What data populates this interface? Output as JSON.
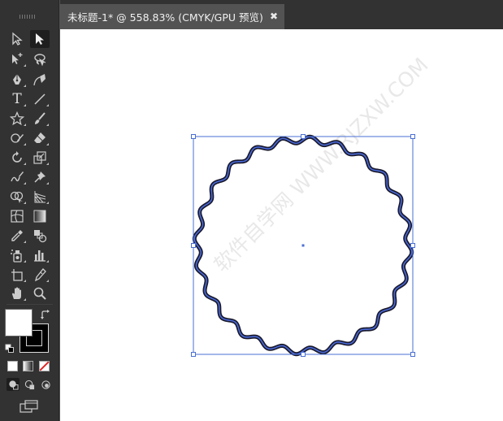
{
  "document_tab": {
    "title": "未标题-1* @ 558.83% (CMYK/GPU 预览)",
    "close_glyph": "✖"
  },
  "toolbar": {
    "tools": [
      {
        "name": "direct-selection-icon"
      },
      {
        "name": "selection-icon",
        "active": true
      },
      {
        "name": "magic-wand-icon"
      },
      {
        "name": "lasso-icon"
      },
      {
        "name": "pen-icon"
      },
      {
        "name": "curvature-icon"
      },
      {
        "name": "type-icon",
        "glyph": "T"
      },
      {
        "name": "line-segment-icon"
      },
      {
        "name": "star-icon"
      },
      {
        "name": "paintbrush-icon"
      },
      {
        "name": "shaper-icon"
      },
      {
        "name": "eraser-icon"
      },
      {
        "name": "rotate-icon"
      },
      {
        "name": "scale-icon"
      },
      {
        "name": "warp-icon"
      },
      {
        "name": "puppet-warp-icon"
      },
      {
        "name": "shape-builder-icon"
      },
      {
        "name": "perspective-grid-icon"
      },
      {
        "name": "mesh-icon"
      },
      {
        "name": "gradient-icon"
      },
      {
        "name": "eyedropper-icon"
      },
      {
        "name": "blend-icon"
      },
      {
        "name": "symbol-sprayer-icon"
      },
      {
        "name": "column-graph-icon"
      },
      {
        "name": "artboard-icon"
      },
      {
        "name": "slice-icon"
      },
      {
        "name": "hand-icon"
      },
      {
        "name": "zoom-icon"
      }
    ],
    "fill_color": "#ffffff",
    "stroke_color": "#000000"
  },
  "canvas": {
    "background": "#ffffff",
    "shape": {
      "type": "wavy-circle",
      "stroke_color": "#1a1a2e",
      "inner_stroke_color": "#4a6ad8",
      "selection_color": "#4a6fd4"
    },
    "watermark": "软件自学网 WWW.RJZXW.COM"
  }
}
